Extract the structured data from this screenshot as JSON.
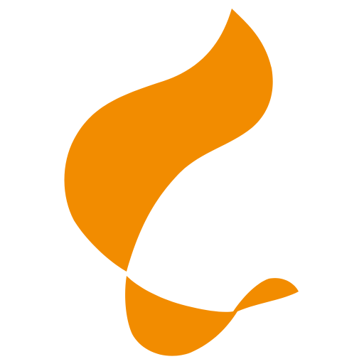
{
  "logo": {
    "icon": "orange-flame-swirl-logo-icon",
    "color": "#F28C00",
    "background": "#FFFFFF"
  }
}
